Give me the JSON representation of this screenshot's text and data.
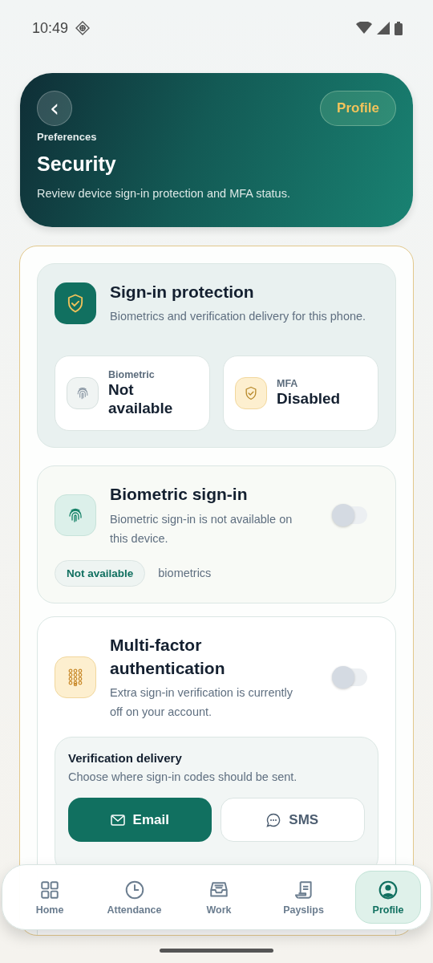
{
  "status_bar": {
    "time": "10:49"
  },
  "header": {
    "back_label": "‹",
    "eyebrow": "Preferences",
    "title": "Security",
    "subtitle": "Review device sign-in protection and MFA status.",
    "profile_button": "Profile"
  },
  "overview": {
    "title": "Sign-in protection",
    "subtitle": "Biometrics and verification delivery for this phone.",
    "stats": [
      {
        "kind": "biometric",
        "label": "Biometric",
        "value": "Not available"
      },
      {
        "kind": "mfa",
        "label": "MFA",
        "value": "Disabled"
      }
    ]
  },
  "biometric": {
    "title": "Biometric sign-in",
    "subtitle": "Biometric sign-in is not available on this device.",
    "on": false,
    "chip": "Not available",
    "note": "biometrics"
  },
  "mfa": {
    "title": "Multi-factor authentication",
    "subtitle": "Extra sign-in verification is currently off on your account.",
    "on": false,
    "delivery": {
      "title": "Verification delivery",
      "subtitle": "Choose where sign-in codes should be sent.",
      "options": [
        {
          "kind": "email",
          "label": "Email",
          "selected": true
        },
        {
          "kind": "sms",
          "label": "SMS",
          "selected": false
        }
      ]
    }
  },
  "nav": [
    {
      "kind": "home",
      "label": "Home",
      "selected": false
    },
    {
      "kind": "attendance",
      "label": "Attendance",
      "selected": false
    },
    {
      "kind": "work",
      "label": "Work",
      "selected": false
    },
    {
      "kind": "payslips",
      "label": "Payslips",
      "selected": false
    },
    {
      "kind": "profile",
      "label": "Profile",
      "selected": true
    }
  ]
}
